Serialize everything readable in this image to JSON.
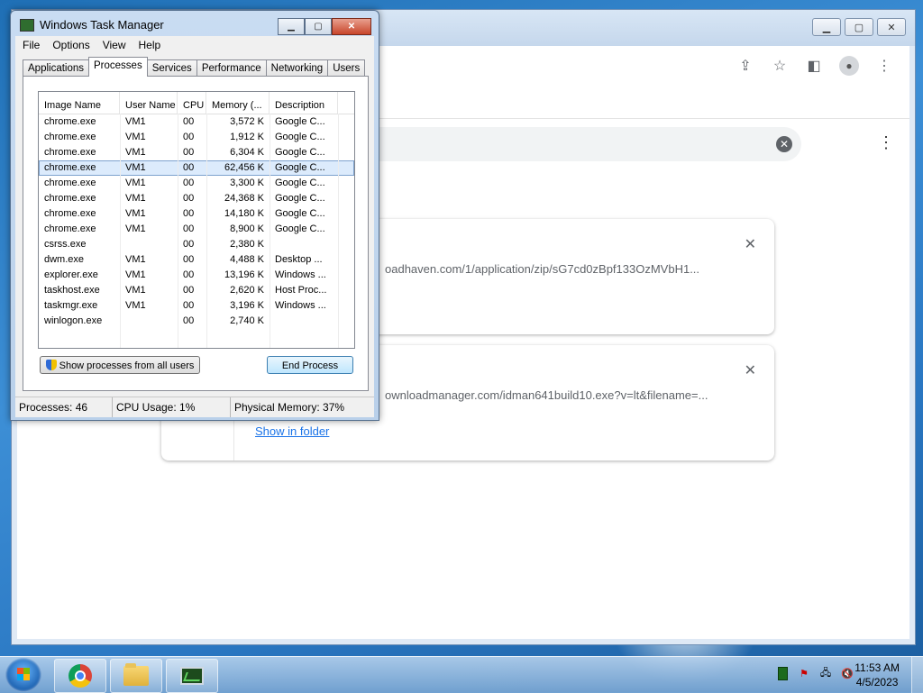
{
  "task_manager": {
    "title": "Windows Task Manager",
    "menu": [
      "File",
      "Options",
      "View",
      "Help"
    ],
    "tabs": [
      "Applications",
      "Processes",
      "Services",
      "Performance",
      "Networking",
      "Users"
    ],
    "active_tab": "Processes",
    "columns": [
      "Image Name",
      "User Name",
      "CPU",
      "Memory (...",
      "Description"
    ],
    "processes": [
      {
        "name": "chrome.exe",
        "user": "VM1",
        "cpu": "00",
        "memory": "3,572 K",
        "desc": "Google C..."
      },
      {
        "name": "chrome.exe",
        "user": "VM1",
        "cpu": "00",
        "memory": "1,912 K",
        "desc": "Google C..."
      },
      {
        "name": "chrome.exe",
        "user": "VM1",
        "cpu": "00",
        "memory": "6,304 K",
        "desc": "Google C..."
      },
      {
        "name": "chrome.exe",
        "user": "VM1",
        "cpu": "00",
        "memory": "62,456 K",
        "desc": "Google C...",
        "selected": true
      },
      {
        "name": "chrome.exe",
        "user": "VM1",
        "cpu": "00",
        "memory": "3,300 K",
        "desc": "Google C..."
      },
      {
        "name": "chrome.exe",
        "user": "VM1",
        "cpu": "00",
        "memory": "24,368 K",
        "desc": "Google C..."
      },
      {
        "name": "chrome.exe",
        "user": "VM1",
        "cpu": "00",
        "memory": "14,180 K",
        "desc": "Google C..."
      },
      {
        "name": "chrome.exe",
        "user": "VM1",
        "cpu": "00",
        "memory": "8,900 K",
        "desc": "Google C..."
      },
      {
        "name": "csrss.exe",
        "user": "",
        "cpu": "00",
        "memory": "2,380 K",
        "desc": ""
      },
      {
        "name": "dwm.exe",
        "user": "VM1",
        "cpu": "00",
        "memory": "4,488 K",
        "desc": "Desktop ..."
      },
      {
        "name": "explorer.exe",
        "user": "VM1",
        "cpu": "00",
        "memory": "13,196 K",
        "desc": "Windows ..."
      },
      {
        "name": "taskhost.exe",
        "user": "VM1",
        "cpu": "00",
        "memory": "2,620 K",
        "desc": "Host Proc..."
      },
      {
        "name": "taskmgr.exe",
        "user": "VM1",
        "cpu": "00",
        "memory": "3,196 K",
        "desc": "Windows ..."
      },
      {
        "name": "winlogon.exe",
        "user": "",
        "cpu": "00",
        "memory": "2,740 K",
        "desc": ""
      }
    ],
    "show_all_label": "Show processes from all users",
    "end_process_label": "End Process",
    "status": {
      "processes": "Processes: 46",
      "cpu": "CPU Usage: 1%",
      "memory": "Physical Memory: 37%"
    }
  },
  "chrome": {
    "downloads": [
      {
        "url": "oadhaven.com/1/application/zip/sG7cd0zBpf133OzMVbH1...",
        "link": ""
      },
      {
        "url": "ownloadmanager.com/idman641build10.exe?v=lt&filename=...",
        "link": "Show in folder"
      }
    ]
  },
  "taskbar": {
    "time": "11:53 AM",
    "date": "4/5/2023"
  }
}
